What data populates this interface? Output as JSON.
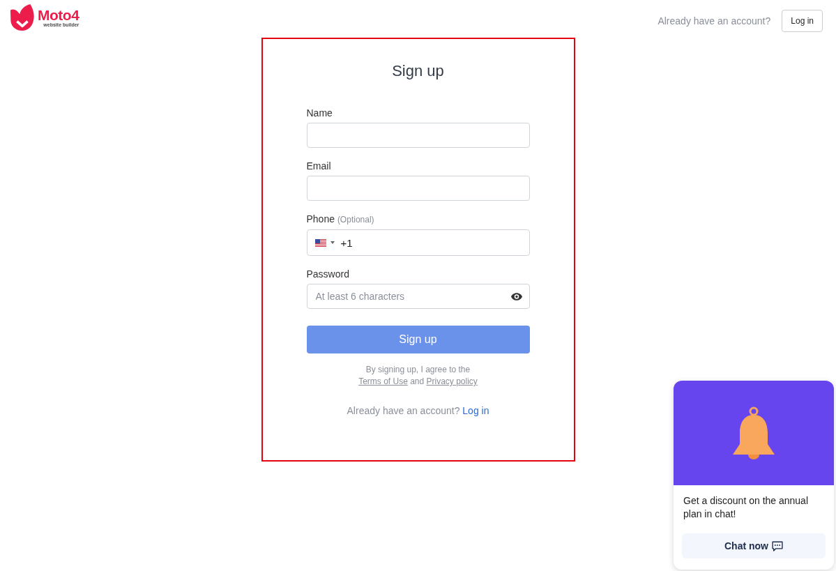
{
  "header": {
    "logo": {
      "name": "Moto4",
      "tagline": "website builder"
    },
    "prompt": "Already have an account?",
    "login_button": "Log in"
  },
  "form": {
    "highlighted": true,
    "title": "Sign up",
    "fields": [
      {
        "kind": "name",
        "label": "Name"
      },
      {
        "kind": "email",
        "label": "Email"
      },
      {
        "kind": "phone",
        "label": "Phone",
        "note": "(Optional)",
        "value": "+1"
      },
      {
        "kind": "password",
        "label": "Password",
        "placeholder": "At least 6 characters"
      }
    ],
    "submit": {
      "label": "Sign up",
      "disabled": true
    },
    "terms": {
      "text": "By signing up, I agree to the",
      "links": [
        "Terms of Use",
        "Privacy policy"
      ],
      "joiner": "and"
    },
    "footer": {
      "prompt": "Already have an account?",
      "link": "Log in"
    }
  },
  "chat_popup": {
    "message": "Get a discount on the annual plan in chat!",
    "button": "Chat now"
  }
}
